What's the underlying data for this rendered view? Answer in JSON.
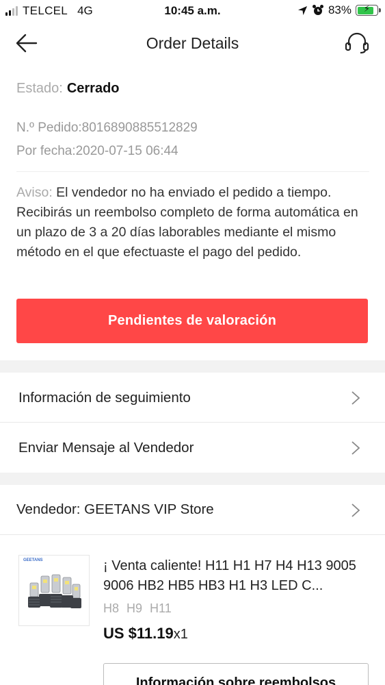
{
  "status_bar": {
    "carrier": "TELCEL",
    "network": "4G",
    "time": "10:45 a.m.",
    "battery_percent": "83%",
    "battery_level": 0.83,
    "battery_color": "#31c44a"
  },
  "header": {
    "title": "Order Details",
    "back_icon": "arrow-left-icon",
    "support_icon": "headset-icon"
  },
  "order": {
    "status_label": "Estado:",
    "status_value": "Cerrado",
    "order_number": "N.º Pedido:8016890885512829",
    "order_date": "Por fecha:2020-07-15 06:44",
    "notice_label": "Aviso:",
    "notice_text": " El vendedor no ha enviado el pedido a tiempo. Recibirás un reembolso completo de forma automática en un plazo de 3 a 20 días laborables mediante el mismo método en el que efectuaste el pago del pedido."
  },
  "actions": {
    "rate_button": "Pendientes de valoración",
    "accent_color": "#ff4747"
  },
  "menu": {
    "tracking": "Información de seguimiento",
    "message_seller": "Enviar Mensaje al Vendedor"
  },
  "seller": {
    "label": "Vendedor: GEETANS VIP Store"
  },
  "product": {
    "image_brand": "GEETANS",
    "title": "¡ Venta caliente! H11 H1 H7 H4 H13 9005 9006 HB2 HB5 HB3 H1 H3 LED C...",
    "variant": "H8 H9 H11",
    "price": "US $11.19",
    "quantity": "x1",
    "refund_button": "Información sobre reembolsos"
  }
}
